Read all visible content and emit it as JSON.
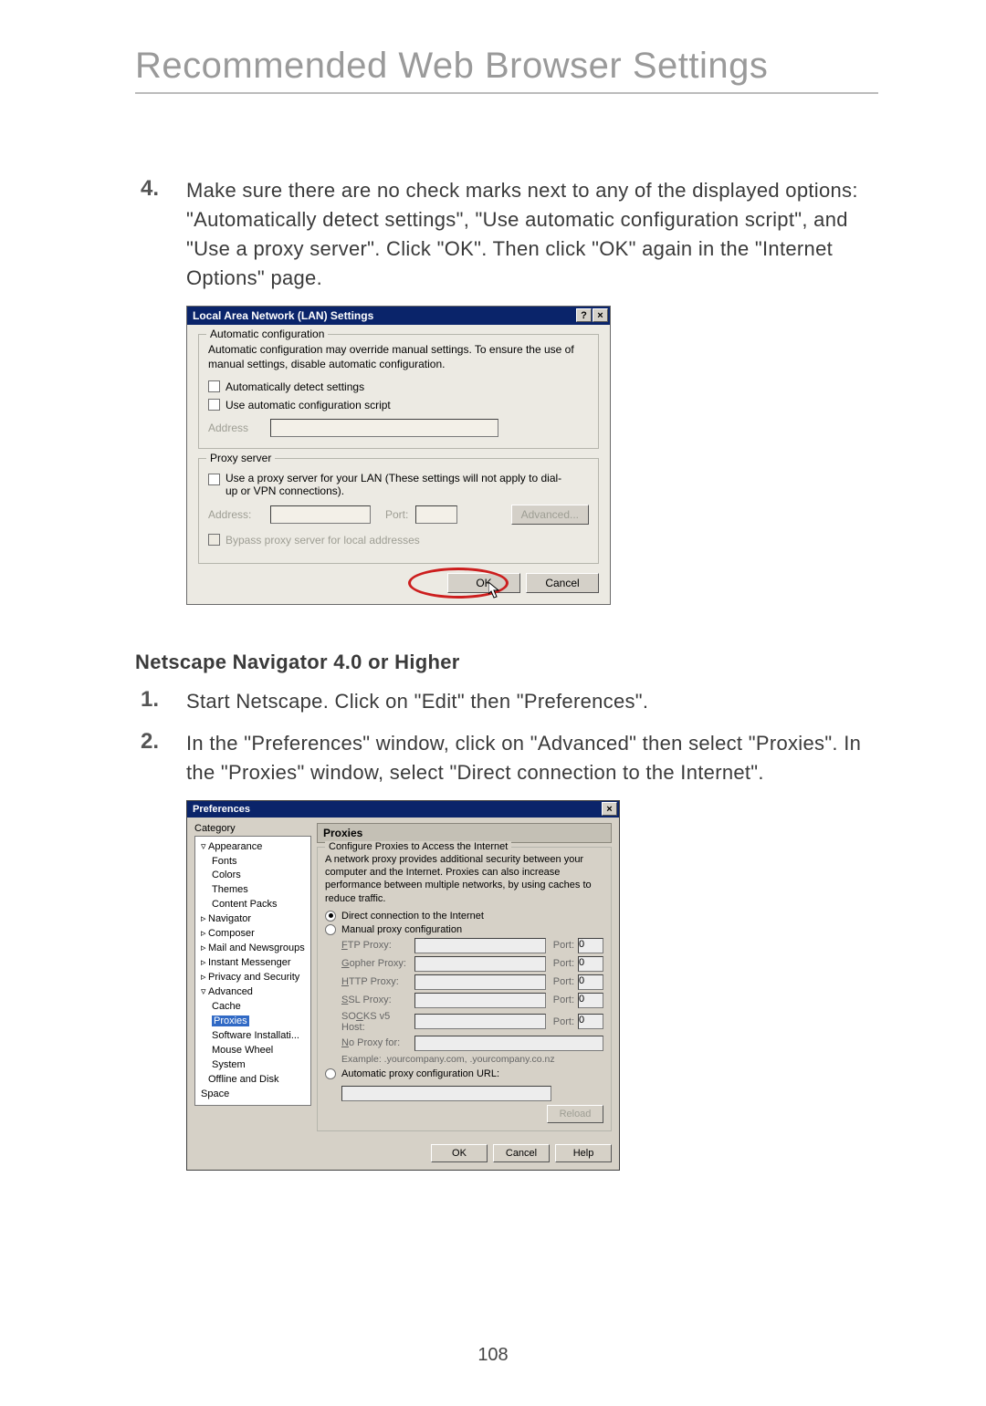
{
  "title": "Recommended Web Browser Settings",
  "page_number": "108",
  "step4": {
    "num": "4.",
    "text": "Make sure there are no check marks next to any of the displayed options: \"Automatically detect settings\", \"Use automatic configuration script\", and \"Use a proxy server\". Click \"OK\". Then click \"OK\" again in the \"Internet Options\" page."
  },
  "lan": {
    "title": "Local Area Network (LAN) Settings",
    "help": "?",
    "close": "×",
    "autoconf": {
      "legend": "Automatic configuration",
      "desc": "Automatic configuration may override manual settings.  To ensure the use of manual settings, disable automatic configuration.",
      "chk1": "Automatically detect settings",
      "chk2": "Use automatic configuration script",
      "address": "Address"
    },
    "proxy": {
      "legend": "Proxy server",
      "chk": "Use a proxy server for your LAN (These settings will not apply to dial-up or VPN connections).",
      "address": "Address:",
      "port": "Port:",
      "advanced": "Advanced...",
      "bypass": "Bypass proxy server for local addresses"
    },
    "ok": "OK",
    "cancel": "Cancel"
  },
  "netscape_heading": "Netscape Navigator 4.0 or Higher",
  "ns_step1": {
    "num": "1.",
    "text": "Start Netscape. Click on \"Edit\" then \"Preferences\"."
  },
  "ns_step2": {
    "num": "2.",
    "text": "In the \"Preferences\" window, click on \"Advanced\" then select \"Proxies\". In the \"Proxies\" window, select \"Direct connection to the Internet\"."
  },
  "ns": {
    "title": "Preferences",
    "close": "×",
    "category": "Category",
    "tree": {
      "appearance": "Appearance",
      "fonts": "Fonts",
      "colors": "Colors",
      "themes": "Themes",
      "content_packs": "Content Packs",
      "navigator": "Navigator",
      "composer": "Composer",
      "mail": "Mail and Newsgroups",
      "im": "Instant Messenger",
      "privacy": "Privacy and Security",
      "advanced": "Advanced",
      "cache": "Cache",
      "proxies": "Proxies",
      "software": "Software Installati...",
      "mouse": "Mouse Wheel",
      "system": "System",
      "offline": "Offline and Disk Space"
    },
    "hdr": "Proxies",
    "fieldset_legend": "Configure Proxies to Access the Internet",
    "desc": "A network proxy provides additional security between your computer and the Internet. Proxies can also increase performance between multiple networks, by using caches to reduce traffic.",
    "r_direct": "Direct connection to the Internet",
    "r_manual": "Manual proxy configuration",
    "ftp": "FTP Proxy:",
    "gopher": "Gopher Proxy:",
    "http": "HTTP Proxy:",
    "ssl": "SSL Proxy:",
    "socks": "SOCKS v5 Host:",
    "noproxy": "No Proxy for:",
    "port": "Port:",
    "port_val": "0",
    "example": "Example: .yourcompany.com, .yourcompany.co.nz",
    "r_auto": "Automatic proxy configuration URL:",
    "reload": "Reload",
    "ok": "OK",
    "cancel": "Cancel",
    "help": "Help"
  }
}
